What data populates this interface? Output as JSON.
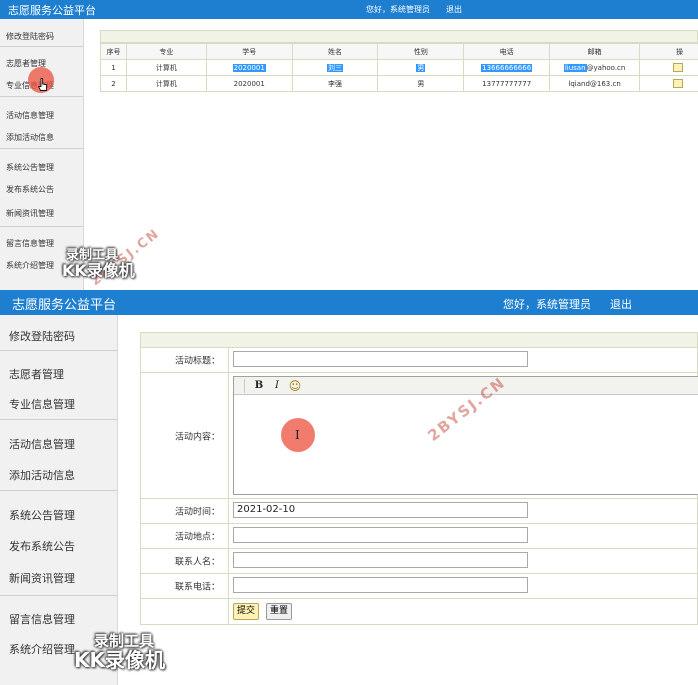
{
  "app": {
    "title": "志愿服务公益平台",
    "greeting": "您好，系统管理员",
    "logout": "退出"
  },
  "sidebar": {
    "items": [
      {
        "label": "修改登陆密码"
      },
      {
        "label": "志愿者管理"
      },
      {
        "label": "专业信息管理"
      },
      {
        "label": "活动信息管理"
      },
      {
        "label": "添加活动信息"
      },
      {
        "label": "系统公告管理"
      },
      {
        "label": "发布系统公告"
      },
      {
        "label": "新闻资讯管理"
      },
      {
        "label": "留言信息管理"
      },
      {
        "label": "系统介绍管理"
      }
    ]
  },
  "volunteer_table": {
    "columns": [
      "序号",
      "专业",
      "学号",
      "姓名",
      "性别",
      "电话",
      "邮箱",
      "操"
    ],
    "rows": [
      {
        "no": "1",
        "major": "计算机",
        "sid": "2020001",
        "name": "刘三",
        "gender": "男",
        "phone": "13666666666",
        "email_user": "liusan",
        "email_domain": "@yahoo.cn"
      },
      {
        "no": "2",
        "major": "计算机",
        "sid": "2020001",
        "name": "李强",
        "gender": "男",
        "phone": "13777777777",
        "email_user": "lqiand@163.cn",
        "email_domain": ""
      }
    ]
  },
  "activity_form": {
    "title_label": "活动标题：",
    "title_value": "",
    "content_label": "活动内容：",
    "editor_toolbar": {
      "bold": "B",
      "italic": "I",
      "emoji": "☺"
    },
    "time_label": "活动时间：",
    "time_value": "2021-02-10",
    "place_label": "活动地点：",
    "place_value": "",
    "contact_label": "联系人名：",
    "contact_value": "",
    "phone_label": "联系电话：",
    "phone_value": "",
    "submit_label": "提交",
    "reset_label": "重置"
  },
  "overlays": {
    "watermark": "2BYSJ.CN",
    "recorder_line1": "录制工具",
    "recorder_line2": "KK录像机",
    "cursor_color": "#ec503c"
  },
  "colors": {
    "header": "#1e7fd0",
    "sidebar": "#f1f1f1",
    "selection": "#3399ff",
    "form_border": "#d6dcc4"
  }
}
